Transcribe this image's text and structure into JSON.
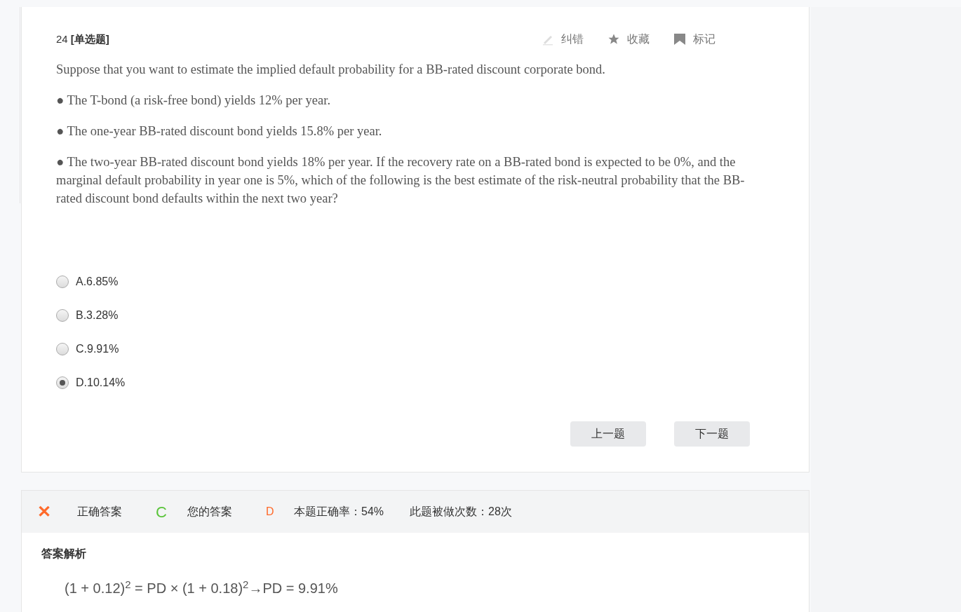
{
  "question": {
    "title": "24 **[单选题]**",
    "actions": [
      {
        "kind": "pencil",
        "label": "纠错"
      },
      {
        "kind": "star",
        "label": "收藏"
      },
      {
        "kind": "bookmark",
        "label": "标记"
      }
    ],
    "paragraphs": [
      "Suppose that you want to estimate the implied default probability for a BB-rated discount corporate bond.",
      "● The T-bond (a risk-free bond) yields 12% per year.",
      "● The one-year BB-rated discount bond yields 15.8% per year.",
      "● The two-year BB-rated discount bond yields 18% per year. If the recovery rate on a BB-rated bond is expected to be 0%, and the marginal default probability in year one is 5%, which of the following is the best estimate of the risk-neutral probability that the BB-rated discount bond defaults within the next two year?"
    ],
    "options": [
      {
        "label": "A.6.85%",
        "selected": false
      },
      {
        "label": "B.3.28%",
        "selected": false
      },
      {
        "label": "C.9.91%",
        "selected": false
      },
      {
        "label": "D.10.14%",
        "selected": true
      }
    ],
    "nav_buttons": [
      "上一题",
      "下一题"
    ]
  },
  "result": {
    "mark": "✕",
    "correct_label": "正确答案",
    "correct_answer": "C",
    "your_label": "您的答案",
    "your_answer": "D",
    "accuracy": "本题正确率：54%",
    "attempts": "此题被做次数：28次"
  },
  "analysis": {
    "title": "答案解析",
    "formula": "(1 + 0.12)$^{2}$ = PD × (1 + 0.18)$^{2}$→PD = 9.91%"
  }
}
